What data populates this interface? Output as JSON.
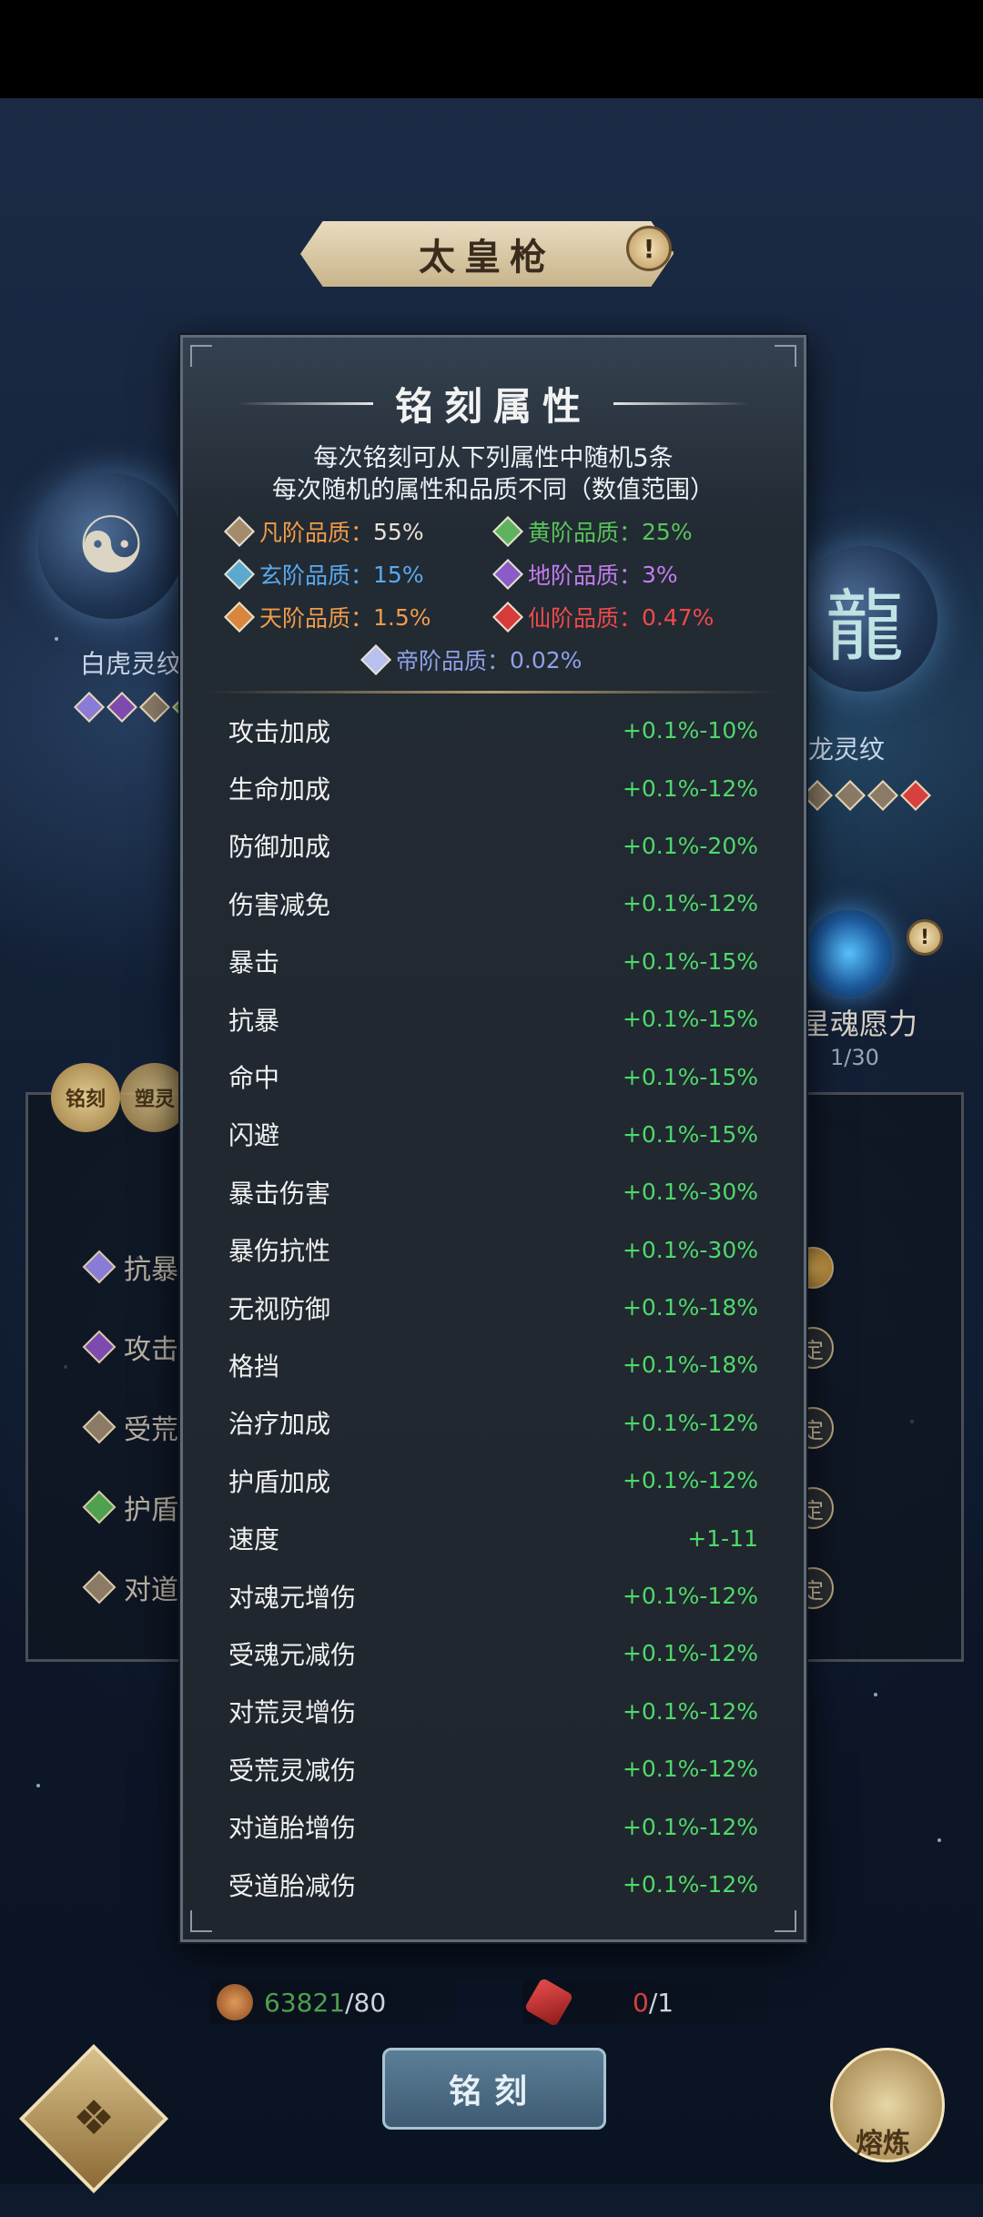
{
  "weapon": {
    "name": "太皇枪",
    "alert": "!"
  },
  "left_emblem": {
    "label": "白虎灵纹",
    "icon": "tiger-icon"
  },
  "right_emblem": {
    "label": "龙灵纹",
    "icon": "dragon-icon"
  },
  "star_soul": {
    "label": "星魂愿力",
    "count": "1/30",
    "alert": "!"
  },
  "tabs": {
    "engrave_short": "铭刻",
    "soul_short": "塑灵"
  },
  "under_rows": [
    {
      "label": "抗暴",
      "color": "#8a7bd6"
    },
    {
      "label": "攻击",
      "color": "#7d4bb0"
    },
    {
      "label": "受荒",
      "color": "#8a7a66"
    },
    {
      "label": "护盾",
      "color": "#4fa04f"
    },
    {
      "label": "对道",
      "color": "#8a7a66"
    }
  ],
  "lock_label": "定",
  "dialog": {
    "title": "铭刻属性",
    "desc_line1": "每次铭刻可从下列属性中随机5条",
    "desc_line2": "每次随机的属性和品质不同（数值范围）",
    "qualities": [
      {
        "label": "凡阶品质：",
        "value": "55%",
        "color": "#e8e2d4",
        "gem": "#a38b6d"
      },
      {
        "label": "黄阶品质：",
        "value": "25%",
        "color": "#58c55a",
        "gem": "#5fb35f"
      },
      {
        "label": "玄阶品质：",
        "value": "15%",
        "color": "#5aaaf0",
        "gem": "#5aaad0"
      },
      {
        "label": "地阶品质：",
        "value": "3%",
        "color": "#c57cf0",
        "gem": "#8b5bc8"
      },
      {
        "label": "天阶品质：",
        "value": "1.5%",
        "color": "#f09c4a",
        "gem": "#d9863c"
      },
      {
        "label": "仙阶品质：",
        "value": "0.47%",
        "color": "#f04a4a",
        "gem": "#d83a3a"
      },
      {
        "label": "帝阶品质：",
        "value": "0.02%",
        "color": "#8ea2e8",
        "gem": "#b8c0f0"
      }
    ],
    "attributes": [
      {
        "name": "攻击加成",
        "range": "+0.1%-10%"
      },
      {
        "name": "生命加成",
        "range": "+0.1%-12%"
      },
      {
        "name": "防御加成",
        "range": "+0.1%-20%"
      },
      {
        "name": "伤害减免",
        "range": "+0.1%-12%"
      },
      {
        "name": "暴击",
        "range": "+0.1%-15%"
      },
      {
        "name": "抗暴",
        "range": "+0.1%-15%"
      },
      {
        "name": "命中",
        "range": "+0.1%-15%"
      },
      {
        "name": "闪避",
        "range": "+0.1%-15%"
      },
      {
        "name": "暴击伤害",
        "range": "+0.1%-30%"
      },
      {
        "name": "暴伤抗性",
        "range": "+0.1%-30%"
      },
      {
        "name": "无视防御",
        "range": "+0.1%-18%"
      },
      {
        "name": "格挡",
        "range": "+0.1%-18%"
      },
      {
        "name": "治疗加成",
        "range": "+0.1%-12%"
      },
      {
        "name": "护盾加成",
        "range": "+0.1%-12%"
      },
      {
        "name": "速度",
        "range": "+1-11"
      },
      {
        "name": "对魂元增伤",
        "range": "+0.1%-12%"
      },
      {
        "name": "受魂元减伤",
        "range": "+0.1%-12%"
      },
      {
        "name": "对荒灵增伤",
        "range": "+0.1%-12%"
      },
      {
        "name": "受荒灵减伤",
        "range": "+0.1%-12%"
      },
      {
        "name": "对道胎增伤",
        "range": "+0.1%-12%"
      },
      {
        "name": "受道胎减伤",
        "range": "+0.1%-12%"
      }
    ]
  },
  "resources": [
    {
      "owned": "63821",
      "need": "/80",
      "owned_color": "#4fa04f",
      "icon": "pouch-icon"
    },
    {
      "owned": "0",
      "need": "/1",
      "owned_color": "#d84040",
      "icon": "crystal-icon"
    }
  ],
  "engrave_button": "铭刻",
  "smelt_label": "熔炼"
}
